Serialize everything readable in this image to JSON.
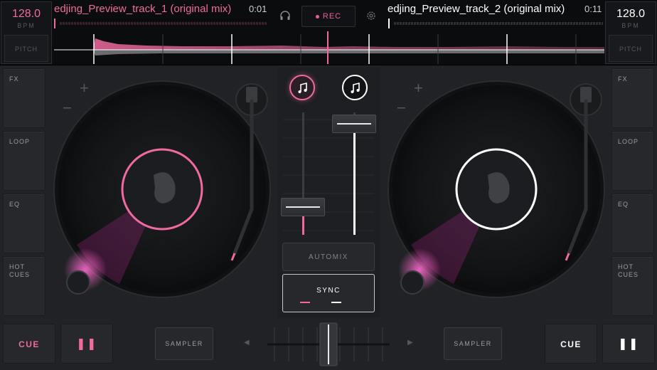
{
  "deck_left": {
    "bpm": "128.0",
    "bpm_unit": "BPM",
    "pitch_label": "PITCH",
    "track_title": "edjing_Preview_track_1 (original mix)",
    "time": "0:01",
    "accent_color": "#f06aa0"
  },
  "deck_right": {
    "bpm": "128.0",
    "bpm_unit": "BPM",
    "pitch_label": "PITCH",
    "track_title": "edjing_Preview_track_2 (original mix)",
    "time": "0:11",
    "accent_color": "#ffffff"
  },
  "header": {
    "rec_label": "REC",
    "headphones_icon": "headphones-icon",
    "settings_icon": "gear-icon"
  },
  "side_buttons": {
    "left": [
      "FX",
      "LOOP",
      "EQ",
      "HOT\nCUES"
    ],
    "right": [
      "FX",
      "LOOP",
      "EQ",
      "HOT\nCUES"
    ]
  },
  "mixer": {
    "automix_label": "AUTOMIX",
    "sync_label": "SYNC",
    "volume_left": 0.18,
    "volume_right": 0.98
  },
  "transport": {
    "cue_left": "CUE",
    "pause_left": "❚❚",
    "sampler_left": "SAMPLER",
    "sampler_right": "SAMPLER",
    "cue_right": "CUE",
    "pause_right": "❚❚"
  },
  "crossfader": {
    "position": 0.5
  }
}
